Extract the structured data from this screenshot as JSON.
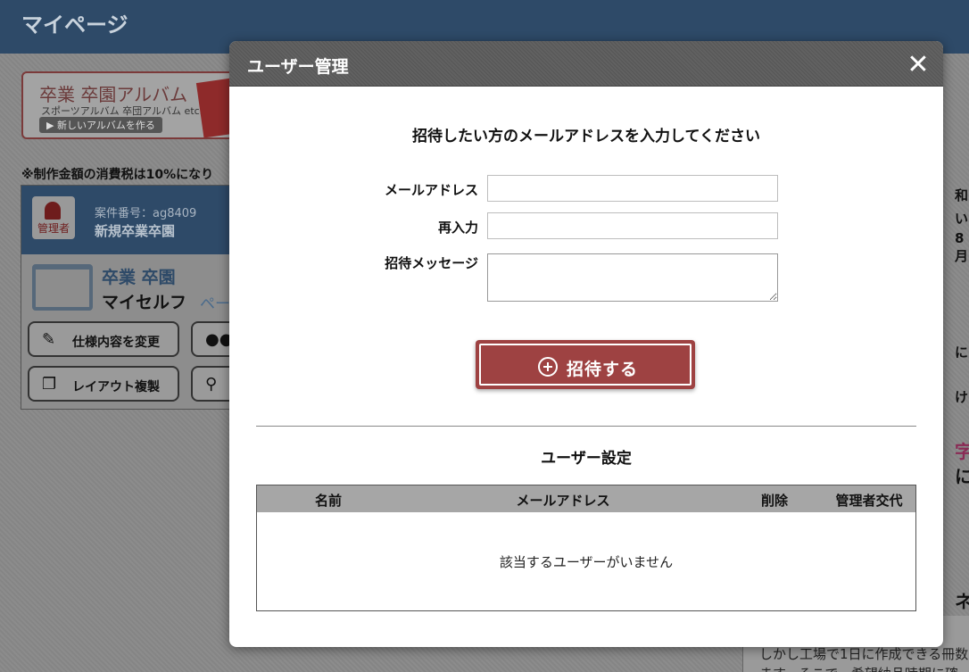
{
  "page": {
    "title": "マイページ",
    "banner": {
      "main": "卒業 卒園アルバム",
      "sub": "スポーツアルバム 卒団アルバム etc.",
      "cta": "▶ 新しいアルバムを作る"
    },
    "tax_note": "※制作金額の消費税は10%になり",
    "card": {
      "badge": "管理者",
      "case_number": "案件番号：ag8409",
      "case_name": "新規卒業卒園",
      "brand": "卒業 卒園",
      "subtitle": "マイセルフ",
      "subtitle2": "ペー",
      "buttons": {
        "spec": "仕様内容を変更",
        "users": "",
        "layout": "レイアウト複製",
        "search": ""
      }
    },
    "right_strip": [
      "和",
      "い",
      "8月",
      "に",
      "け",
      "字",
      "に",
      "ネ"
    ],
    "bottom_panel": {
      "line1": "しかし工場で1日に作成できる冊数",
      "line2": "ます。そこで、希望納品時期に確"
    }
  },
  "modal": {
    "title": "ユーザー管理",
    "close_glyph": "✕",
    "instruction": "招待したい方のメールアドレスを入力してください",
    "form": {
      "email_label": "メールアドレス",
      "email_value": "",
      "confirm_label": "再入力",
      "confirm_value": "",
      "message_label": "招待メッセージ",
      "message_value": ""
    },
    "invite_button": "招待する",
    "user_settings": {
      "title": "ユーザー設定",
      "columns": [
        "名前",
        "メールアドレス",
        "削除",
        "管理者交代"
      ],
      "empty_message": "該当するユーザーがいません"
    }
  }
}
